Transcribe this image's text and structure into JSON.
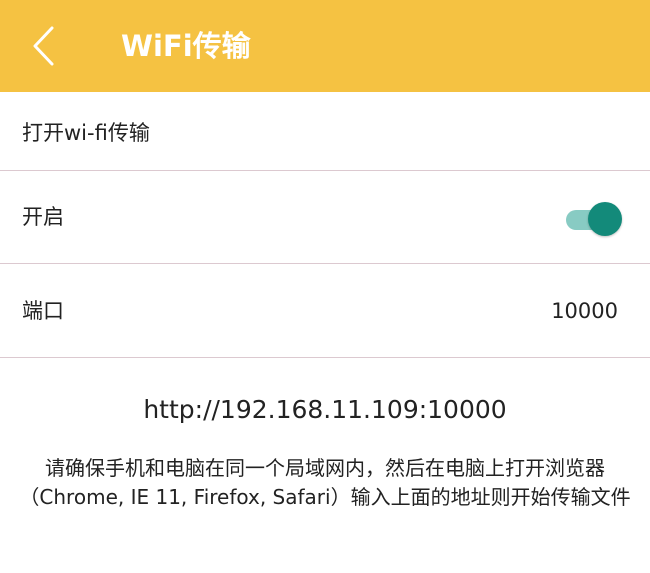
{
  "header": {
    "back_icon": "chevron-left-icon",
    "title": "WiFi传输",
    "background_color": "#f5c242"
  },
  "settings": {
    "section_title": "打开wi-fi传输",
    "enable_label": "开启",
    "enabled": true,
    "port_label": "端口",
    "port_value": "10000"
  },
  "info": {
    "url": "http://192.168.11.109:10000",
    "instructions": "请确保手机和电脑在同一个局域网内，然后在电脑上打开浏览器（Chrome, IE 11, Firefox, Safari）输入上面的地址则开始传输文件"
  },
  "colors": {
    "toggle_track": "#88cbc3",
    "toggle_thumb": "#138a7a",
    "divider": "#dcc9d0"
  }
}
